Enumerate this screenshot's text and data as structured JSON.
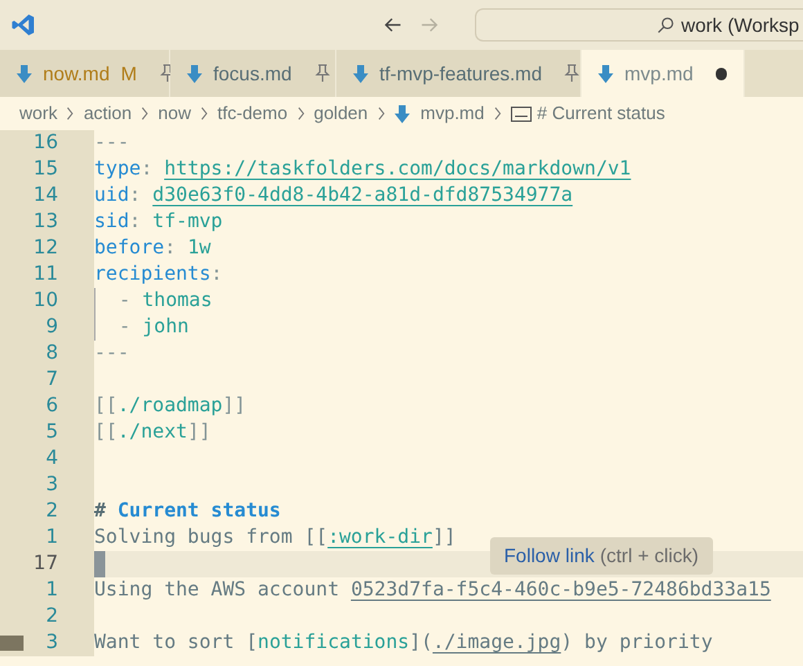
{
  "title_bar": {
    "back": {
      "disabled": false
    },
    "forward": {
      "disabled": true
    },
    "search": {
      "value": "work (Worksp"
    }
  },
  "tabs": [
    {
      "label": "now.md",
      "modified_badge": "M",
      "pinned": true,
      "dirty": false,
      "modified": true,
      "selected": false
    },
    {
      "label": "focus.md",
      "pinned": true,
      "dirty": false,
      "modified": false,
      "selected": false
    },
    {
      "label": "tf-mvp-features.md",
      "pinned": true,
      "dirty": false,
      "modified": false,
      "selected": false
    },
    {
      "label": "mvp.md",
      "pinned": false,
      "dirty": true,
      "modified": false,
      "selected": true
    }
  ],
  "breadcrumbs": [
    {
      "kind": "folder",
      "label": "work"
    },
    {
      "kind": "folder",
      "label": "action"
    },
    {
      "kind": "folder",
      "label": "now"
    },
    {
      "kind": "folder",
      "label": "tfc-demo"
    },
    {
      "kind": "folder",
      "label": "golden"
    },
    {
      "kind": "file",
      "label": "mvp.md"
    },
    {
      "kind": "symbol",
      "label": "# Current status"
    }
  ],
  "editor": {
    "lines": [
      {
        "number": "16",
        "segments": [
          {
            "kind": "punct",
            "text": "---"
          }
        ]
      },
      {
        "number": "15",
        "segments": [
          {
            "kind": "key",
            "text": "type"
          },
          {
            "kind": "punct",
            "text": ": "
          },
          {
            "kind": "link",
            "text": "https://taskfolders.com/docs/markdown/v1"
          }
        ]
      },
      {
        "number": "14",
        "segments": [
          {
            "kind": "key",
            "text": "uid"
          },
          {
            "kind": "punct",
            "text": ": "
          },
          {
            "kind": "link",
            "text": "d30e63f0-4dd8-4b42-a81d-dfd87534977a"
          }
        ]
      },
      {
        "number": "13",
        "segments": [
          {
            "kind": "key",
            "text": "sid"
          },
          {
            "kind": "punct",
            "text": ": "
          },
          {
            "kind": "value",
            "text": "tf-mvp"
          }
        ]
      },
      {
        "number": "12",
        "segments": [
          {
            "kind": "key",
            "text": "before"
          },
          {
            "kind": "punct",
            "text": ": "
          },
          {
            "kind": "value",
            "text": "1w"
          }
        ]
      },
      {
        "number": "11",
        "segments": [
          {
            "kind": "key",
            "text": "recipients"
          },
          {
            "kind": "punct",
            "text": ":"
          }
        ]
      },
      {
        "number": "10",
        "guide": true,
        "segments": [
          {
            "kind": "punct",
            "text": "  - "
          },
          {
            "kind": "value",
            "text": "thomas"
          }
        ]
      },
      {
        "number": "9",
        "guide": true,
        "segments": [
          {
            "kind": "punct",
            "text": "  - "
          },
          {
            "kind": "value",
            "text": "john"
          }
        ]
      },
      {
        "number": "8",
        "segments": [
          {
            "kind": "punct",
            "text": "---"
          }
        ]
      },
      {
        "number": "7"
      },
      {
        "number": "6",
        "segments": [
          {
            "kind": "punct",
            "text": "[["
          },
          {
            "kind": "value",
            "text": "./roadmap"
          },
          {
            "kind": "punct",
            "text": "]]"
          }
        ]
      },
      {
        "number": "5",
        "segments": [
          {
            "kind": "punct",
            "text": "[["
          },
          {
            "kind": "value",
            "text": "./next"
          },
          {
            "kind": "punct",
            "text": "]]"
          }
        ]
      },
      {
        "number": "4"
      },
      {
        "number": "3"
      },
      {
        "number": "2",
        "segments": [
          {
            "kind": "heading-mark",
            "text": "# "
          },
          {
            "kind": "heading",
            "text": "Current status"
          }
        ]
      },
      {
        "number": "1",
        "segments": [
          {
            "kind": "plain",
            "text": "Solving bugs from [["
          },
          {
            "kind": "link",
            "text": ":work-dir"
          },
          {
            "kind": "plain",
            "text": "]]"
          }
        ]
      },
      {
        "number": "17",
        "current": true
      },
      {
        "number": "1",
        "segments": [
          {
            "kind": "plain",
            "text": "Using the AWS account "
          },
          {
            "kind": "plain-link",
            "text": "0523d7fa-f5c4-460c-b9e5-72486bd33a15"
          }
        ]
      },
      {
        "number": "2"
      },
      {
        "number": "3",
        "thumbnail": true,
        "segments": [
          {
            "kind": "plain",
            "text": "Want to sort ["
          },
          {
            "kind": "value",
            "text": "notifications"
          },
          {
            "kind": "plain",
            "text": "]("
          },
          {
            "kind": "plain-link",
            "text": "./image.jpg"
          },
          {
            "kind": "plain",
            "text": ") by priority"
          }
        ]
      }
    ]
  },
  "tooltip": {
    "link": "Follow link",
    "hint": "(ctrl + click)"
  }
}
